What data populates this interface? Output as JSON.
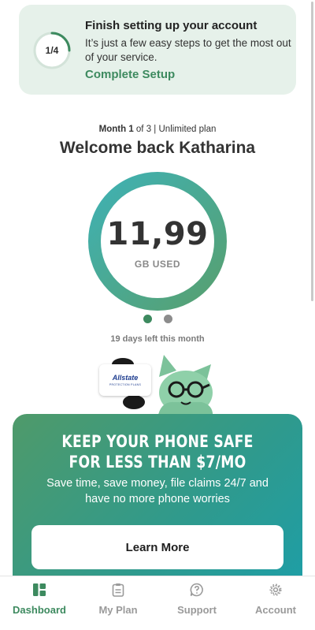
{
  "setup": {
    "progress_label": "1/4",
    "progress_fraction": 0.25,
    "title": "Finish setting up your account",
    "description": "It’s just a few easy steps to get the most out of your service.",
    "link_label": "Complete Setup"
  },
  "plan": {
    "month_word": "Month",
    "month_current": "1",
    "month_total_text": " of 3",
    "separator": " | ",
    "plan_name": "Unlimited  plan"
  },
  "welcome": "Welcome back Katharina",
  "usage": {
    "value": "11,99",
    "unit": "GB USED"
  },
  "days_left": "19 days left this month",
  "promo": {
    "title_line1": "KEEP YOUR PHONE SAFE",
    "title_line2": "FOR LESS THAN $7/MO",
    "description": "Save time, save money, file claims 24/7 and have no more phone worries",
    "button_label": "Learn More",
    "brand_name": "Allstate",
    "brand_sub": "PROTECTION PLANS"
  },
  "nav": {
    "items": [
      {
        "label": "Dashboard",
        "icon": "dashboard-icon",
        "active": true
      },
      {
        "label": "My Plan",
        "icon": "clipboard-icon",
        "active": false
      },
      {
        "label": "Support",
        "icon": "question-icon",
        "active": false
      },
      {
        "label": "Account",
        "icon": "gear-icon",
        "active": false
      }
    ]
  },
  "colors": {
    "brand_green": "#3d8a5f",
    "setup_bg": "#e6f1ea",
    "promo_start": "#4f9a6a",
    "promo_end": "#1e9ea6"
  }
}
